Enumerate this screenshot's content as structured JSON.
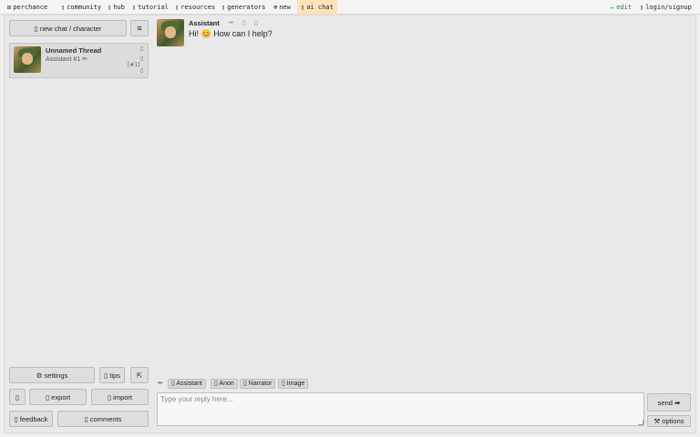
{
  "nav": {
    "perchance": {
      "icon": "dice-icon",
      "glyph": "⚄",
      "label": "perchance"
    },
    "community": {
      "icon": "community-icon",
      "glyph": "▯",
      "label": "community"
    },
    "hub": {
      "icon": "hub-icon",
      "glyph": "▯",
      "label": "hub"
    },
    "tutorial": {
      "icon": "tutorial-icon",
      "glyph": "▯",
      "label": "tutorial"
    },
    "resources": {
      "icon": "resources-icon",
      "glyph": "▯",
      "label": "resources"
    },
    "generators": {
      "icon": "generators-icon",
      "glyph": "▯",
      "label": "generators"
    },
    "new": {
      "icon": "plus-circle-icon",
      "glyph": "⊕",
      "label": "new"
    },
    "ai_chat": {
      "icon": "chat-icon",
      "glyph": "▯",
      "label": "ai chat"
    },
    "edit": {
      "icon": "pencil-icon",
      "glyph": "✏",
      "label": "edit"
    },
    "login": {
      "icon": "user-icon",
      "glyph": "▯",
      "label": "login/signup"
    }
  },
  "sidebar": {
    "new_chat_label": "▯ new chat / character",
    "menu_glyph": "≡",
    "thread": {
      "title": "Unnamed Thread",
      "subtitle": "Assistant #1 ✏",
      "count": "[#1]",
      "icon_top": "▯",
      "icon_mid": "▯",
      "icon_bottom": "▯"
    },
    "settings_label": "⚙ settings",
    "tips_label": "▯ tips",
    "collapse_glyph": "⇱",
    "unknown_glyph": "▯",
    "export_label": "▯ export",
    "import_label": "▯ import",
    "feedback_label": "▯ feedback",
    "comments_label": "▯ comments"
  },
  "message": {
    "author": "Assistant",
    "edit_glyph": "✏",
    "action2_glyph": "▯",
    "action3_glyph": "▯",
    "text": "Hi! 😊 How can I help?"
  },
  "composer": {
    "pencil_glyph": "✏",
    "chips": [
      "▯ Assistant",
      "▯ Anon",
      "▯ Narrator",
      "▯ Image"
    ],
    "placeholder": "Type your reply here...",
    "send_label": "send ➡",
    "options_label": "⚒ options"
  },
  "colors": {
    "ai_chat_highlight": "#fde2b8",
    "edit_link": "#2e7d32"
  }
}
